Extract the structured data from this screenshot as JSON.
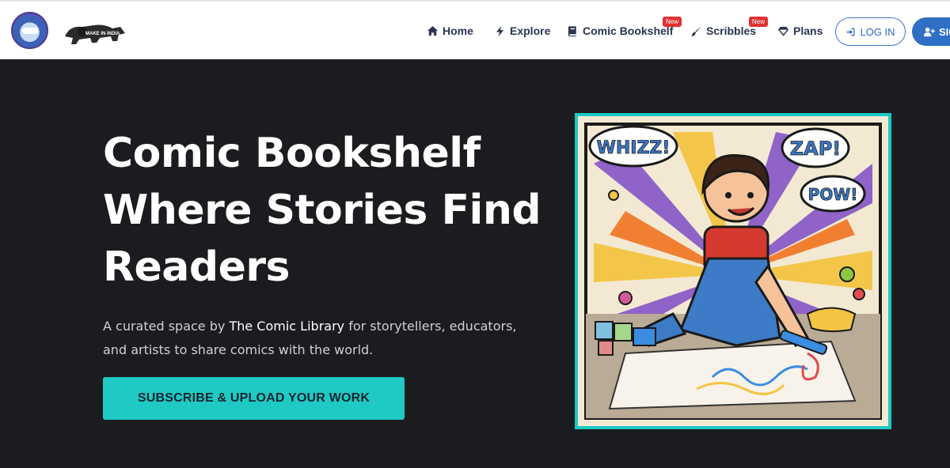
{
  "nav": {
    "logo_alt": "The Comic Library",
    "make_in_india": "MAKE IN INDIA",
    "items": [
      {
        "label": "Home",
        "icon": "home-icon"
      },
      {
        "label": "Explore",
        "icon": "bolt-icon"
      },
      {
        "label": "Comic Bookshelf",
        "icon": "book-icon",
        "badge": "New"
      },
      {
        "label": "Scribbles",
        "icon": "brush-icon",
        "badge": "New"
      },
      {
        "label": "Plans",
        "icon": "diamond-icon"
      }
    ],
    "login_label": "LOG IN",
    "signup_label": "SIG"
  },
  "hero": {
    "title_lines": [
      "Comic Bookshelf",
      "Where Stories Find",
      "Readers"
    ],
    "sub_pre": "A curated space by ",
    "sub_brand": "The Comic Library",
    "sub_post": " for storytellers, educators,",
    "sub_line2": "and artists to share comics with the world.",
    "cta_label": "SUBSCRIBE & UPLOAD YOUR WORK"
  },
  "art": {
    "bubbles": [
      "WHIZZ!",
      "ZAP!",
      "POW!"
    ]
  },
  "colors": {
    "accent": "#1fc9c4",
    "nav_text": "#2b3450",
    "badge": "#e03131",
    "primary_button": "#2f6fc6",
    "background": "#1b1c1f"
  }
}
